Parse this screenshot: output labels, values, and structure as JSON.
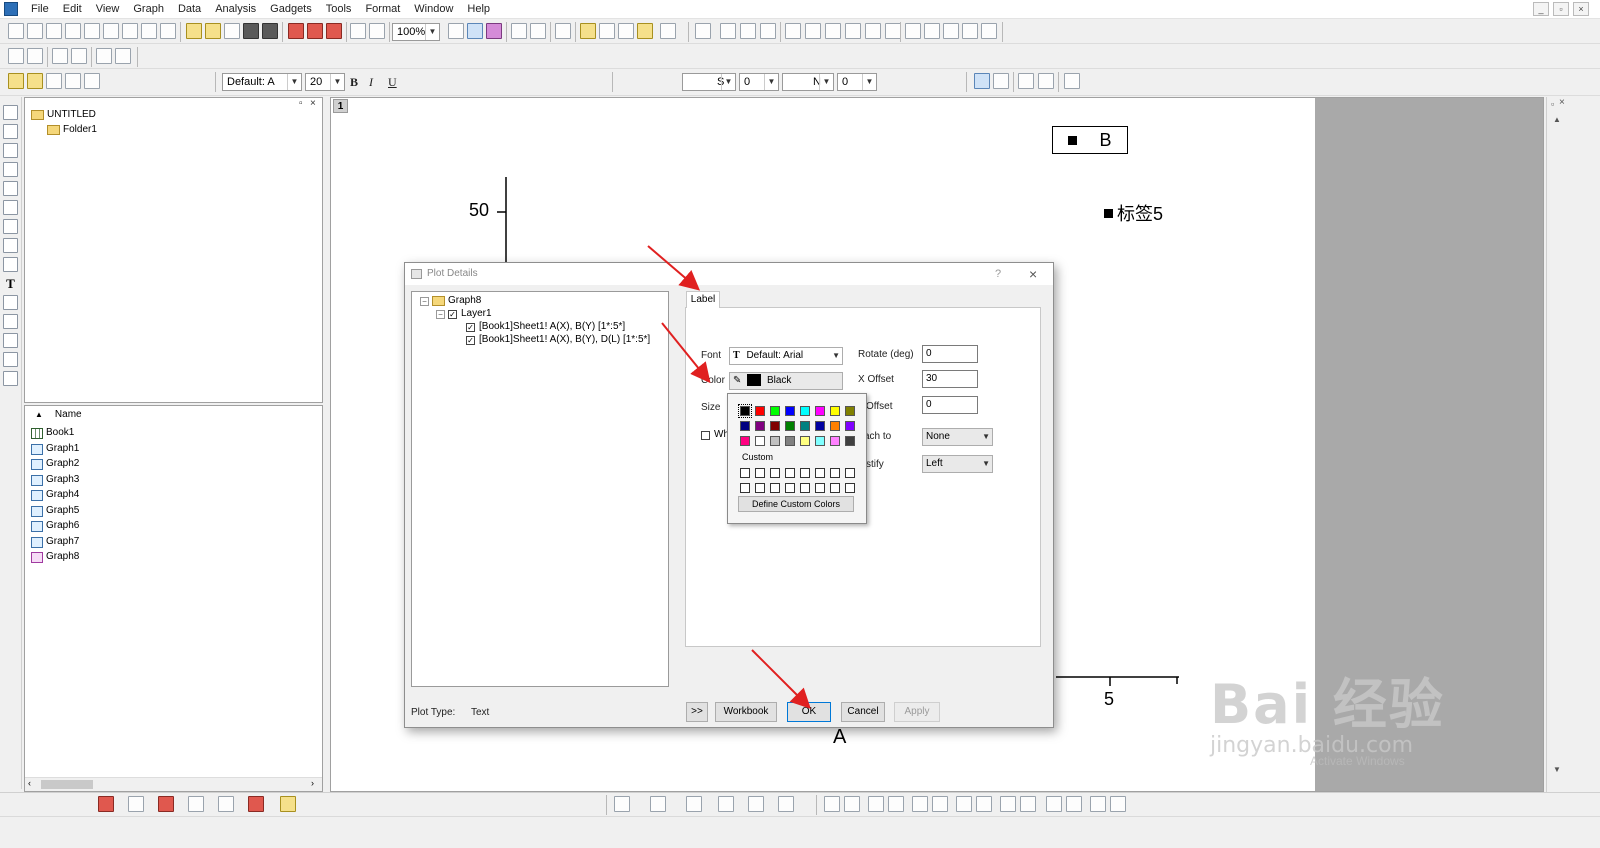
{
  "menu": {
    "items": [
      "File",
      "Edit",
      "View",
      "Graph",
      "Data",
      "Analysis",
      "Gadgets",
      "Tools",
      "Format",
      "Window",
      "Help"
    ],
    "window_controls": [
      "_",
      "▫",
      "×"
    ]
  },
  "toolbar": {
    "zoom": "100%",
    "font_combo": "Default: A",
    "font_size": "20",
    "bold": "B",
    "italic": "I",
    "underline": "U",
    "line_style": "S",
    "line_width": "0",
    "fill_label": "N",
    "fill_value": "0"
  },
  "left_tools": {
    "text_tool": "T"
  },
  "project": {
    "root": "UNTITLED",
    "folder": "Folder1",
    "list_header": "Name",
    "items": [
      {
        "name": "Book1",
        "icon": "workbook-icon"
      },
      {
        "name": "Graph1",
        "icon": "graph-icon"
      },
      {
        "name": "Graph2",
        "icon": "graph-icon"
      },
      {
        "name": "Graph3",
        "icon": "graph-icon"
      },
      {
        "name": "Graph4",
        "icon": "graph-icon"
      },
      {
        "name": "Graph5",
        "icon": "graph-icon"
      },
      {
        "name": "Graph6",
        "icon": "graph-icon"
      },
      {
        "name": "Graph7",
        "icon": "graph-icon"
      },
      {
        "name": "Graph8",
        "icon": "graph-icon-active"
      }
    ]
  },
  "graph": {
    "layer_tab": "1",
    "y_tick": "50",
    "x_tick": "5",
    "x_axis_label": "A",
    "legend_text": "B",
    "data_label": "标签5"
  },
  "dialog": {
    "title": "Plot Details",
    "help": "?",
    "close": "×",
    "tree": {
      "root": "Graph8",
      "layer": "Layer1",
      "plot1": "[Book1]Sheet1! A(X), B(Y) [1*:5*]",
      "plot2": "[Book1]Sheet1! A(X), B(Y), D(L) [1*:5*]"
    },
    "tab": "Label",
    "font_label": "Font",
    "font_value": "Default: Arial",
    "color_label": "Color",
    "color_value": "Black",
    "size_label": "Size",
    "white_out_label": "Wh",
    "rotate_label": "Rotate (deg)",
    "rotate_value": "0",
    "xoffset_label": "X Offset",
    "xoffset_value": "30",
    "yoffset_label": "Offset",
    "yoffset_value": "0",
    "attach_label": "ach to",
    "attach_value": "None",
    "justify_label": "stify",
    "justify_value": "Left",
    "plot_type_label": "Plot Type:",
    "plot_type_value": "Text",
    "buttons": {
      "more": ">>",
      "workbook": "Workbook",
      "ok": "OK",
      "cancel": "Cancel",
      "apply": "Apply"
    },
    "color_popup": {
      "custom_label": "Custom",
      "define_button": "Define Custom Colors",
      "swatches": [
        "#000000",
        "#ff0000",
        "#00ff00",
        "#0000ff",
        "#00ffff",
        "#ff00ff",
        "#ffff00",
        "#808000",
        "#000080",
        "#800080",
        "#800000",
        "#008000",
        "#008080",
        "#0000a0",
        "#ff8000",
        "#8000ff",
        "#ff0080",
        "#ffffff",
        "#c0c0c0",
        "#808080",
        "#ffff80",
        "#80ffff",
        "#ff80ff",
        "#404040"
      ]
    }
  },
  "watermark": {
    "brand": "Bai 经验",
    "url": "jingyan.baidu.com",
    "activate": "Activate Windows"
  },
  "colors": {
    "accent": "#0078d7",
    "arrow": "#e02020",
    "graph_gray": "#a9a9a9"
  }
}
